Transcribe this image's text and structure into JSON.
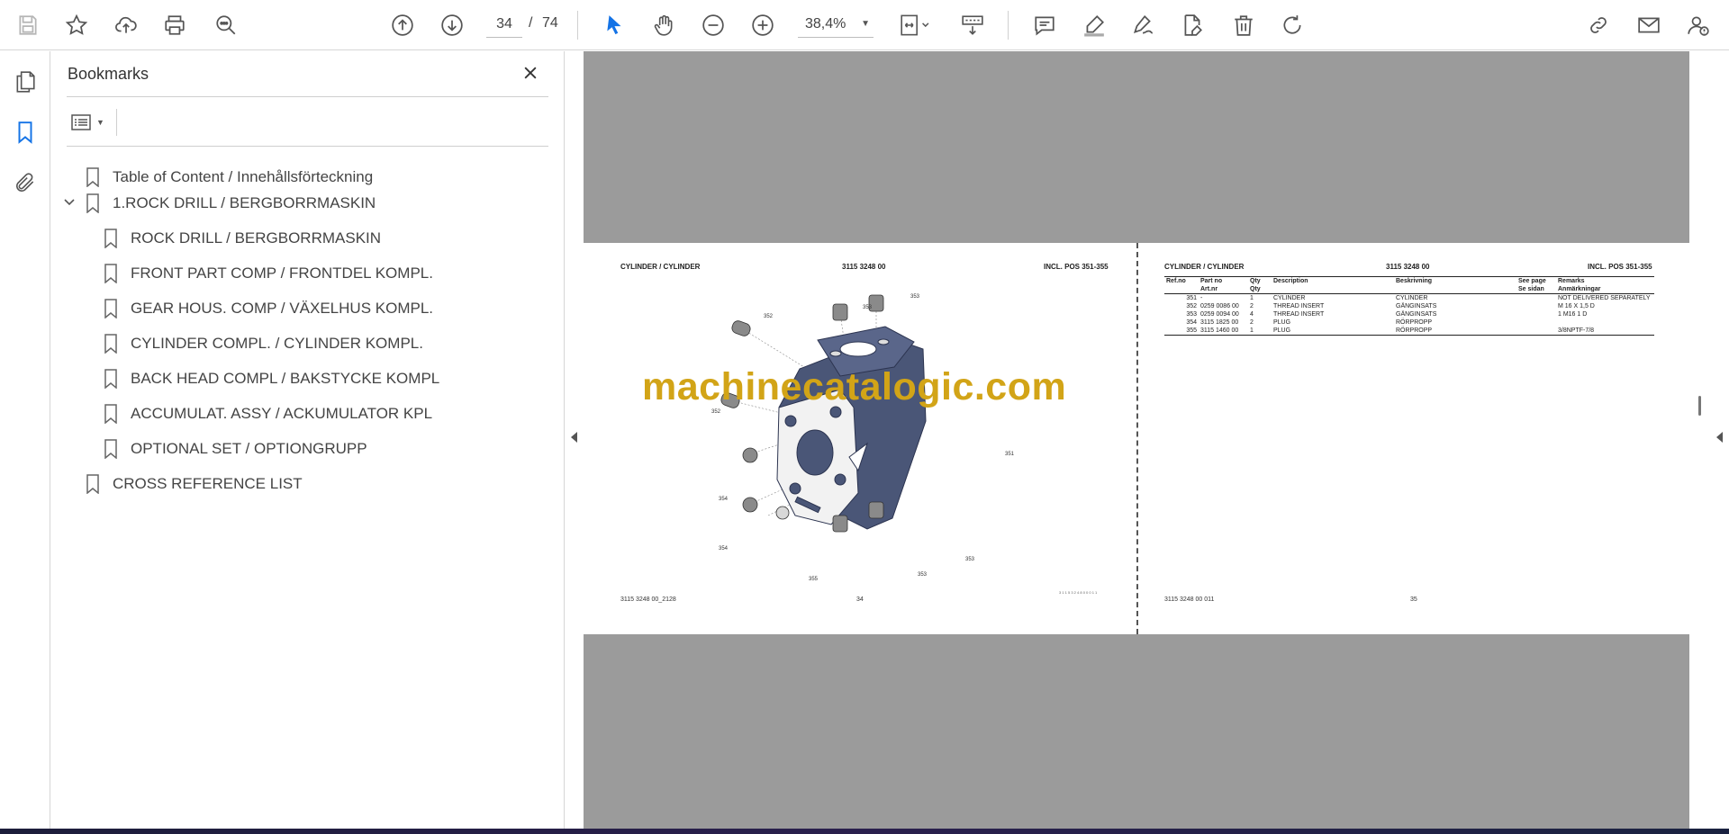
{
  "toolbar": {
    "page_current": "34",
    "page_separator": "/",
    "page_total": "74",
    "zoom": "38,4%"
  },
  "panel": {
    "title": "Bookmarks",
    "items": [
      {
        "label": "Table of Content / Innehållsförteckning",
        "level": 0
      },
      {
        "label": "1.ROCK DRILL / BERGBORRMASKIN",
        "level": 0,
        "expanded": true
      },
      {
        "label": "ROCK DRILL / BERGBORRMASKIN",
        "level": 1
      },
      {
        "label": "FRONT PART COMP / FRONTDEL KOMPL.",
        "level": 1
      },
      {
        "label": "GEAR HOUS. COMP / VÄXELHUS KOMPL.",
        "level": 1
      },
      {
        "label": "CYLINDER COMPL. / CYLINDER KOMPL.",
        "level": 1
      },
      {
        "label": "BACK HEAD COMPL / BAKSTYCKE KOMPL",
        "level": 1
      },
      {
        "label": "ACCUMULAT. ASSY / ACKUMULATOR KPL",
        "level": 1
      },
      {
        "label": "OPTIONAL SET / OPTIONGRUPP",
        "level": 1
      },
      {
        "label": "CROSS REFERENCE LIST",
        "level": 0
      }
    ]
  },
  "left_page": {
    "title": "CYLINDER / CYLINDER",
    "part_no": "3115 3248 00",
    "incl": "INCL. POS 351-355",
    "footer_ref": "3115 3248 00_2128",
    "page_number": "34",
    "drawing_id": "3 1 1 5 3 2 4 8 0 0 0 1 1",
    "callouts": [
      "352",
      "353",
      "353",
      "352",
      "351",
      "354",
      "354",
      "355",
      "353",
      "353"
    ]
  },
  "right_page": {
    "title": "CYLINDER / CYLINDER",
    "part_no": "3115 3248 00",
    "incl": "INCL. POS 351-355",
    "footer_ref": "3115 3248 00 011",
    "page_number": "35",
    "headers": {
      "ref": "Ref.no",
      "partno": "Part no",
      "partno2": "Art.nr",
      "qty": "Qty",
      "qty2": "Qty",
      "desc": "Description",
      "besk": "Beskrivning",
      "seepage": "See page",
      "seepage2": "Se sidan",
      "remarks": "Remarks",
      "remarks2": "Anmärkningar"
    },
    "rows": [
      {
        "ref": "351",
        "part": "-",
        "qty": "1",
        "desc": "CYLINDER",
        "besk": "CYLINDER",
        "page": "",
        "remarks": "NOT DELIVERED SEPARATELY"
      },
      {
        "ref": "352",
        "part": "0259 0086 00",
        "qty": "2",
        "desc": "THREAD INSERT",
        "besk": "GÄNGINSATS",
        "page": "",
        "remarks": "M 16 X 1,5 D"
      },
      {
        "ref": "353",
        "part": "0259 0094 00",
        "qty": "4",
        "desc": "THREAD INSERT",
        "besk": "GÄNGINSATS",
        "page": "",
        "remarks": "1 M16 1 D"
      },
      {
        "ref": "354",
        "part": "3115 1825 00",
        "qty": "2",
        "desc": "PLUG",
        "besk": "RÖRPROPP",
        "page": "",
        "remarks": ""
      },
      {
        "ref": "355",
        "part": "3115 1460 00",
        "qty": "1",
        "desc": "PLUG",
        "besk": "RÖRPROPP",
        "page": "",
        "remarks": "3/8NPTF-7/8"
      }
    ]
  },
  "watermark": "machinecatalogic.com",
  "colors": {
    "accent": "#1473e6",
    "doc_background": "#9b9b9b",
    "watermark": "#d2a417",
    "part_fill": "#4a5677"
  }
}
